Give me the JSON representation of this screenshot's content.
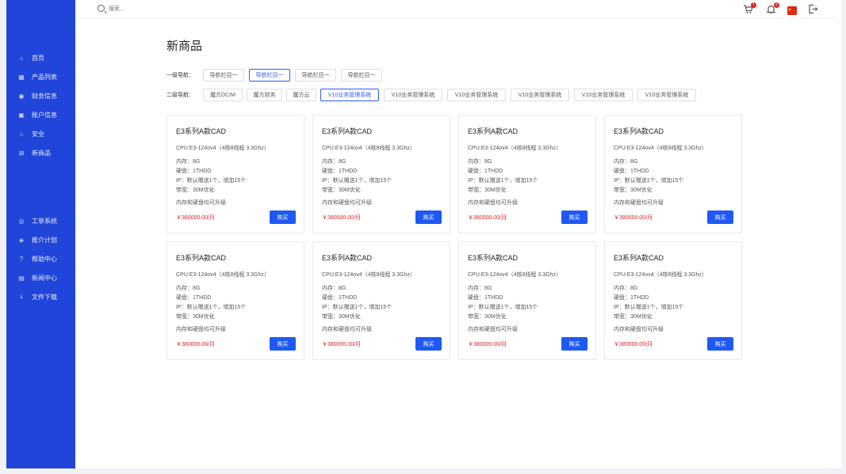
{
  "sidebar": {
    "items": [
      {
        "label": "首页",
        "icon": "home-icon"
      },
      {
        "label": "产品列表",
        "icon": "grid-icon"
      },
      {
        "label": "财务信息",
        "icon": "finance-icon"
      },
      {
        "label": "账户信息",
        "icon": "account-icon"
      },
      {
        "label": "安全",
        "icon": "lock-icon"
      },
      {
        "label": "新商品",
        "icon": "cart-icon"
      }
    ],
    "items2": [
      {
        "label": "工单系统",
        "icon": "ticket-icon"
      },
      {
        "label": "推介计划",
        "icon": "tag-icon"
      },
      {
        "label": "帮助中心",
        "icon": "help-icon"
      },
      {
        "label": "新闻中心",
        "icon": "news-icon"
      },
      {
        "label": "文件下载",
        "icon": "download-icon"
      }
    ]
  },
  "search": {
    "placeholder": "搜索..."
  },
  "header": {
    "cart_badge": "1",
    "notify_badge": "2",
    "flag_icon": "china-flag-icon",
    "logout_icon": "logout-icon"
  },
  "page": {
    "title": "新商品"
  },
  "filters": {
    "level1_label": "一级导航：",
    "level1": [
      "导航栏目一",
      "导航栏目一",
      "导航栏目一",
      "导航栏目一"
    ],
    "level1_active": 1,
    "level2_label": "二级导航：",
    "level2": [
      "魔方DCIM",
      "魔方财务",
      "魔方云",
      "V10业务管理系统",
      "V10业务管理系统",
      "V10业务管理系统",
      "V10业务管理系统",
      "V10业务管理系统",
      "V10业务管理系统"
    ],
    "level2_active": 3
  },
  "products": [
    {
      "title": "E3系列A款CAD",
      "cpu": "CPU:E3-124ov4（4核8线程 3.3Ghz）",
      "memory": "内存：8G",
      "disk": "硬盘：1THDD",
      "ip": "IP：默认赠送1个，增加15个",
      "bandwidth": "带宽：30M优化",
      "note": "内存和硬盘均可升级",
      "price": "￥380000.00/月",
      "buy": "购买"
    },
    {
      "title": "E3系列A款CAD",
      "cpu": "CPU:E3-124ov4（4核8线程 3.3Ghz）",
      "memory": "内存：8G",
      "disk": "硬盘：1THDD",
      "ip": "IP：默认赠送1个，增加15个",
      "bandwidth": "带宽：30M优化",
      "note": "内存和硬盘均可升级",
      "price": "￥380000.00/月",
      "buy": "购买"
    },
    {
      "title": "E3系列A款CAD",
      "cpu": "CPU:E3-124ov4（4核8线程 3.3Ghz）",
      "memory": "内存：8G",
      "disk": "硬盘：1THDD",
      "ip": "IP：默认赠送1个，增加15个",
      "bandwidth": "带宽：30M优化",
      "note": "内存和硬盘均可升级",
      "price": "￥380000.00/月",
      "buy": "购买"
    },
    {
      "title": "E3系列A款CAD",
      "cpu": "CPU:E3-124ov4（4核8线程 3.3Ghz）",
      "memory": "内存：8G",
      "disk": "硬盘：1THDD",
      "ip": "IP：默认赠送1个，增加15个",
      "bandwidth": "带宽：30M优化",
      "note": "内存和硬盘均可升级",
      "price": "￥380000.00/月",
      "buy": "购买"
    },
    {
      "title": "E3系列A款CAD",
      "cpu": "CPU:E3-124ov4（4核8线程 3.3Ghz）",
      "memory": "内存：8G",
      "disk": "硬盘：1THDD",
      "ip": "IP：默认赠送1个，增加15个",
      "bandwidth": "带宽：30M优化",
      "note": "内存和硬盘均可升级",
      "price": "￥380000.00/月",
      "buy": "购买"
    },
    {
      "title": "E3系列A款CAD",
      "cpu": "CPU:E3-124ov4（4核8线程 3.3Ghz）",
      "memory": "内存：8G",
      "disk": "硬盘：1THDD",
      "ip": "IP：默认赠送1个，增加15个",
      "bandwidth": "带宽：30M优化",
      "note": "内存和硬盘均可升级",
      "price": "￥380000.00/月",
      "buy": "购买"
    },
    {
      "title": "E3系列A款CAD",
      "cpu": "CPU:E3-124ov4（4核8线程 3.3Ghz）",
      "memory": "内存：8G",
      "disk": "硬盘：1THDD",
      "ip": "IP：默认赠送1个，增加15个",
      "bandwidth": "带宽：30M优化",
      "note": "内存和硬盘均可升级",
      "price": "￥380000.00/月",
      "buy": "购买"
    },
    {
      "title": "E3系列A款CAD",
      "cpu": "CPU:E3-124ov4（4核8线程 3.3Ghz）",
      "memory": "内存：8G",
      "disk": "硬盘：1THDD",
      "ip": "IP：默认赠送1个，增加15个",
      "bandwidth": "带宽：30M优化",
      "note": "内存和硬盘均可升级",
      "price": "￥380000.00/月",
      "buy": "购买"
    }
  ],
  "colors": {
    "sidebar": "#2045d8",
    "accent": "#1f59f5",
    "price": "#e02020"
  }
}
